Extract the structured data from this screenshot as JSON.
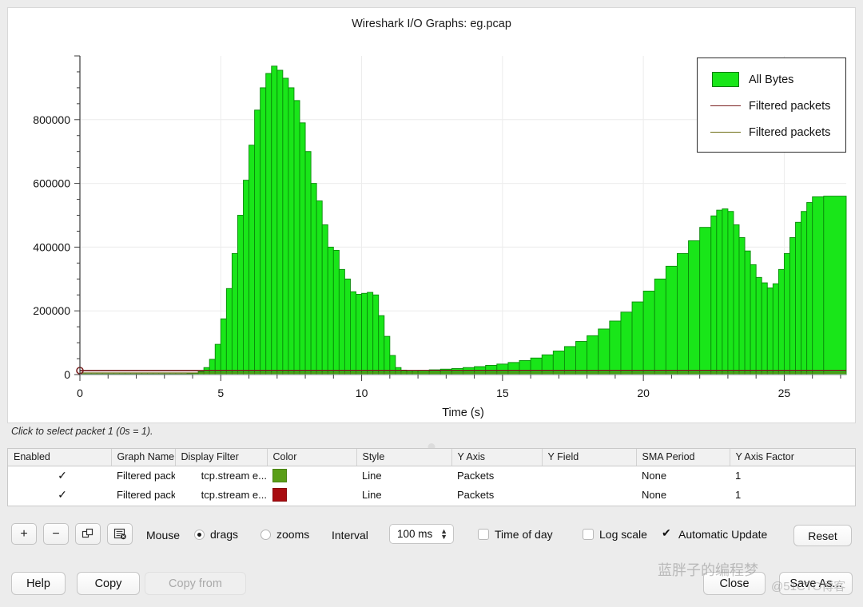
{
  "window": {
    "title": "Wireshark I/O Graphs: eg.pcap"
  },
  "chart_data": {
    "type": "bar",
    "title": "Wireshark I/O Graphs: eg.pcap",
    "xlabel": "Time (s)",
    "ylabel": "",
    "xlim": [
      0,
      27.2
    ],
    "ylim": [
      0,
      1000000
    ],
    "xticks": [
      "0",
      "5",
      "10",
      "15",
      "20",
      "25"
    ],
    "yticks": [
      "0",
      "200000",
      "400000",
      "600000",
      "800000"
    ],
    "grid": true,
    "legend_position": "top-right",
    "series": [
      {
        "name": "All Bytes",
        "style": "bar",
        "color": "#19e619",
        "edge_color": "#0a8a0a",
        "x": [
          0.0,
          0.2,
          0.4,
          0.6,
          0.8,
          1.0,
          1.2,
          1.4,
          1.6,
          1.8,
          2.0,
          2.2,
          2.4,
          2.6,
          2.8,
          3.0,
          3.2,
          3.4,
          3.6,
          3.8,
          4.0,
          4.2,
          4.4,
          4.6,
          4.8,
          5.0,
          5.2,
          5.4,
          5.6,
          5.8,
          6.0,
          6.2,
          6.4,
          6.6,
          6.8,
          7.0,
          7.2,
          7.4,
          7.6,
          7.8,
          8.0,
          8.2,
          8.4,
          8.6,
          8.8,
          9.0,
          9.2,
          9.4,
          9.6,
          9.8,
          10.0,
          10.2,
          10.4,
          10.6,
          10.8,
          11.0,
          11.2,
          11.4,
          11.6,
          11.8,
          12.0,
          12.4,
          12.8,
          13.2,
          13.6,
          14.0,
          14.4,
          14.8,
          15.2,
          15.6,
          16.0,
          16.4,
          16.8,
          17.2,
          17.6,
          18.0,
          18.4,
          18.8,
          19.2,
          19.6,
          20.0,
          20.4,
          20.8,
          21.2,
          21.6,
          22.0,
          22.4,
          22.6,
          22.8,
          23.0,
          23.2,
          23.4,
          23.6,
          23.8,
          24.0,
          24.2,
          24.4,
          24.6,
          24.8,
          25.0,
          25.2,
          25.4,
          25.6,
          25.8,
          26.0,
          26.4
        ],
        "values": [
          2000,
          2000,
          2000,
          2000,
          2000,
          2000,
          2000,
          2000,
          2000,
          2000,
          2000,
          2000,
          2000,
          2000,
          2000,
          2000,
          2000,
          2000,
          2000,
          2500,
          4000,
          9000,
          22000,
          48000,
          95000,
          175000,
          270000,
          380000,
          500000,
          610000,
          720000,
          830000,
          900000,
          945000,
          968000,
          955000,
          930000,
          900000,
          860000,
          790000,
          700000,
          600000,
          545000,
          470000,
          400000,
          390000,
          330000,
          300000,
          260000,
          252000,
          255000,
          258000,
          250000,
          185000,
          120000,
          60000,
          22000,
          14000,
          12000,
          12000,
          13000,
          15000,
          17000,
          19000,
          22000,
          25000,
          29000,
          33000,
          38000,
          44000,
          52000,
          62000,
          74000,
          88000,
          104000,
          122000,
          143000,
          168000,
          196000,
          228000,
          262000,
          300000,
          340000,
          380000,
          420000,
          462000,
          498000,
          516000,
          520000,
          512000,
          470000,
          430000,
          388000,
          345000,
          305000,
          288000,
          272000,
          285000,
          330000,
          380000,
          430000,
          478000,
          512000,
          540000,
          558000,
          560000
        ]
      },
      {
        "name": "Filtered packets",
        "style": "line",
        "color": "#7a2020",
        "marker_x": 0,
        "marker_y": 0
      },
      {
        "name": "Filtered packets",
        "style": "line",
        "color": "#6b6b12"
      }
    ]
  },
  "legend": {
    "items": [
      {
        "label": "All Bytes",
        "kind": "bar",
        "color": "#19e619"
      },
      {
        "label": "Filtered packets",
        "kind": "line",
        "color": "#7a2020"
      },
      {
        "label": "Filtered packets",
        "kind": "line",
        "color": "#6b6b12"
      }
    ]
  },
  "hint": {
    "text": "Click to select packet 1 (0s = 1)."
  },
  "table": {
    "columns": [
      "Enabled",
      "Graph Name",
      "Display Filter",
      "Color",
      "Style",
      "Y Axis",
      "Y Field",
      "SMA Period",
      "Y Axis Factor"
    ],
    "rows": [
      {
        "enabled": "✓",
        "graph_name": "Filtered pack...",
        "display_filter": "tcp.stream e...",
        "color": "#5a9e18",
        "style": "Line",
        "y_axis": "Packets",
        "y_field": "",
        "sma_period": "None",
        "y_axis_factor": "1"
      },
      {
        "enabled": "✓",
        "graph_name": "Filtered pack...",
        "display_filter": "tcp.stream e...",
        "color": "#a80c10",
        "style": "Line",
        "y_axis": "Packets",
        "y_field": "",
        "sma_period": "None",
        "y_axis_factor": "1"
      }
    ]
  },
  "controls": {
    "add_label": "+",
    "remove_label": "−",
    "duplicate_icon": "duplicate-icon",
    "clear_icon": "clear-filter-icon",
    "mouse_label": "Mouse",
    "mouse_options": [
      "drags",
      "zooms"
    ],
    "mouse_selected": "drags",
    "interval_label": "Interval",
    "interval_value": "100 ms",
    "checkboxes": [
      {
        "label": "Time of day",
        "checked": false
      },
      {
        "label": "Log scale",
        "checked": false
      },
      {
        "label": "Automatic Update",
        "checked": true
      }
    ],
    "reset_label": "Reset"
  },
  "buttons": {
    "help": "Help",
    "copy": "Copy",
    "copy_from": "Copy from",
    "close": "Close",
    "save_as": "Save As..."
  },
  "watermark": {
    "line1": "蓝胖子的编程梦",
    "line2": "@51CTO博客"
  }
}
